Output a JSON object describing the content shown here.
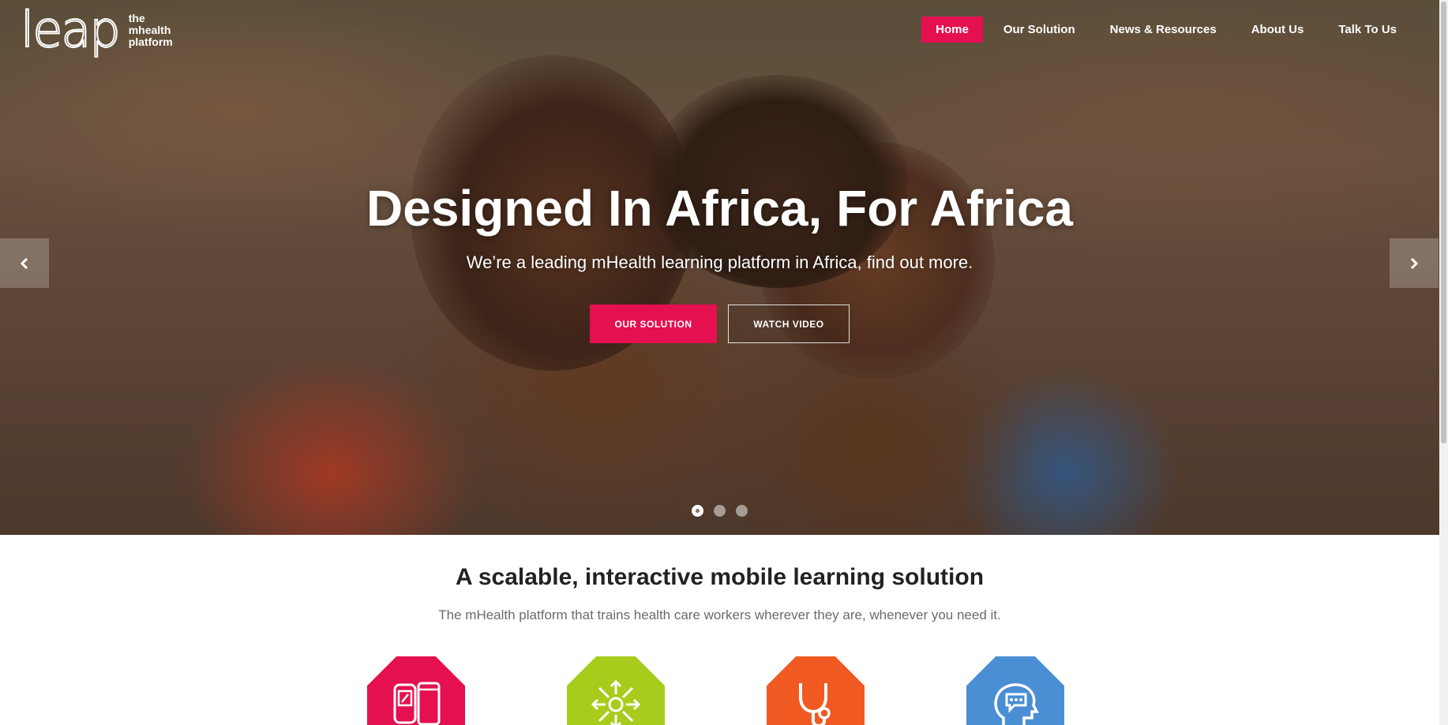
{
  "logo": {
    "mark": "leap",
    "sub": [
      "the",
      "mhealth",
      "platform"
    ]
  },
  "nav": {
    "items": [
      {
        "label": "Home",
        "active": true
      },
      {
        "label": "Our Solution",
        "active": false
      },
      {
        "label": "News & Resources",
        "active": false
      },
      {
        "label": "About Us",
        "active": false
      },
      {
        "label": "Talk To Us",
        "active": false
      }
    ]
  },
  "hero": {
    "title": "Designed In Africa, For Africa",
    "subtitle": "We’re a leading mHealth learning platform in Africa, find out more.",
    "primary_button": "OUR SOLUTION",
    "secondary_button": "WATCH VIDEO",
    "prev_icon": "chevron-left-icon",
    "next_icon": "chevron-right-icon",
    "slides": 3,
    "active_slide": 1
  },
  "section": {
    "title": "A scalable, interactive mobile learning solution",
    "subtitle": "The mHealth platform that trains health care workers wherever they are, whenever you need it.",
    "features": [
      {
        "icon": "mobile-devices-icon",
        "color": "#e4104f"
      },
      {
        "icon": "scale-arrows-icon",
        "color": "#a8cc1c"
      },
      {
        "icon": "stethoscope-icon",
        "color": "#f05a22"
      },
      {
        "icon": "head-chat-icon",
        "color": "#4a8ed4"
      }
    ]
  },
  "colors": {
    "accent": "#e4104f"
  }
}
